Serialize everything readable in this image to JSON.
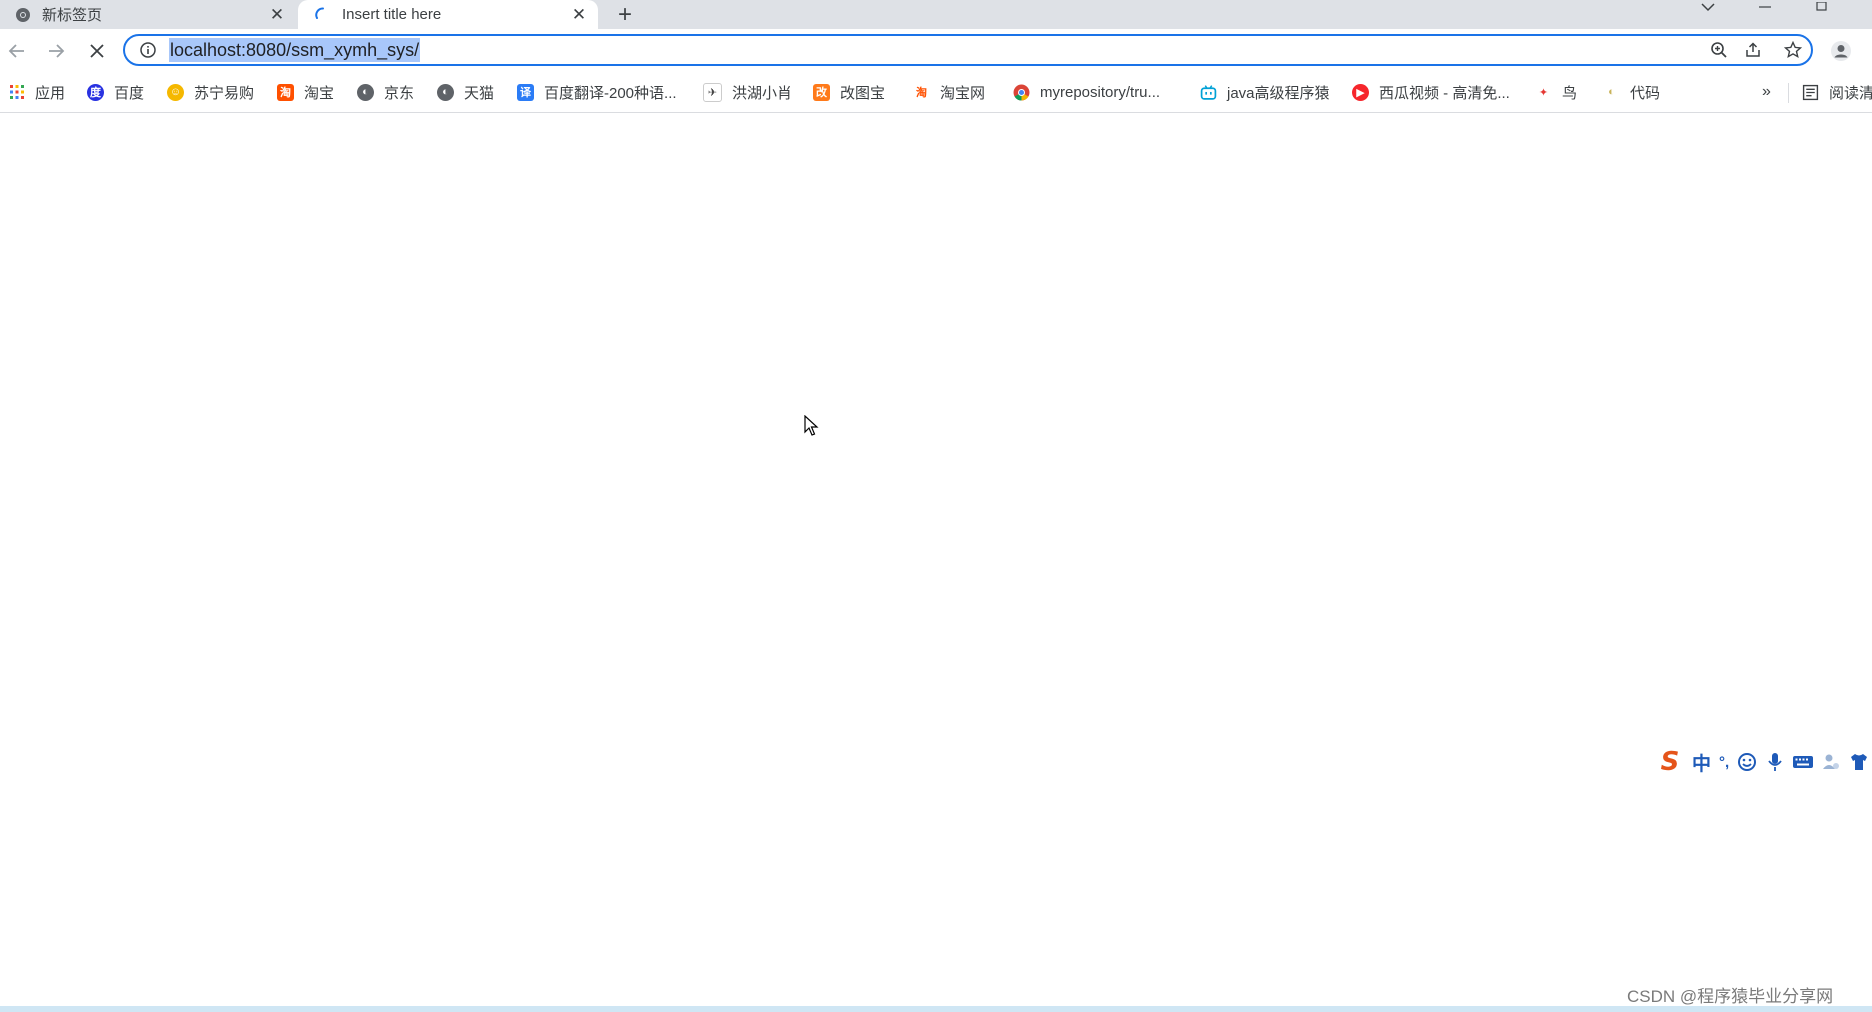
{
  "tabs": [
    {
      "title": "新标签页",
      "active": false
    },
    {
      "title": "Insert title here",
      "active": true
    }
  ],
  "omnibox": {
    "url": "localhost:8080/ssm_xymh_sys/"
  },
  "bookmarks": [
    {
      "label": "应用",
      "icon": "apps-grid-icon"
    },
    {
      "label": "百度",
      "icon": "baidu-paw-icon"
    },
    {
      "label": "苏宁易购",
      "icon": "suning-icon"
    },
    {
      "label": "淘宝",
      "icon": "taobao-icon"
    },
    {
      "label": "京东",
      "icon": "globe-icon"
    },
    {
      "label": "天猫",
      "icon": "globe-icon"
    },
    {
      "label": "百度翻译-200种语...",
      "icon": "translate-icon"
    },
    {
      "label": "洪湖小肖",
      "icon": "bird-icon"
    },
    {
      "label": "改图宝",
      "icon": "gaitubao-icon"
    },
    {
      "label": "淘宝网",
      "icon": "taobao-icon"
    },
    {
      "label": "myrepository/tru...",
      "icon": "chrome-icon"
    },
    {
      "label": "java高级程序猿",
      "icon": "bilibili-icon"
    },
    {
      "label": "西瓜视频 - 高清免...",
      "icon": "xigua-icon"
    },
    {
      "label": "鸟",
      "icon": "bird-icon"
    },
    {
      "label": "代码",
      "icon": "code-icon"
    },
    {
      "label": "阅读清",
      "icon": "reading-list-icon"
    }
  ],
  "bookmarks_overflow": "»",
  "ime": {
    "label_zh": "中",
    "punct": "°,"
  },
  "watermark": "CSDN @程序猿毕业分享网",
  "colors": {
    "accent": "#1a73e8",
    "selection": "#a8c7fa",
    "tabstrip": "#dee1e6"
  }
}
